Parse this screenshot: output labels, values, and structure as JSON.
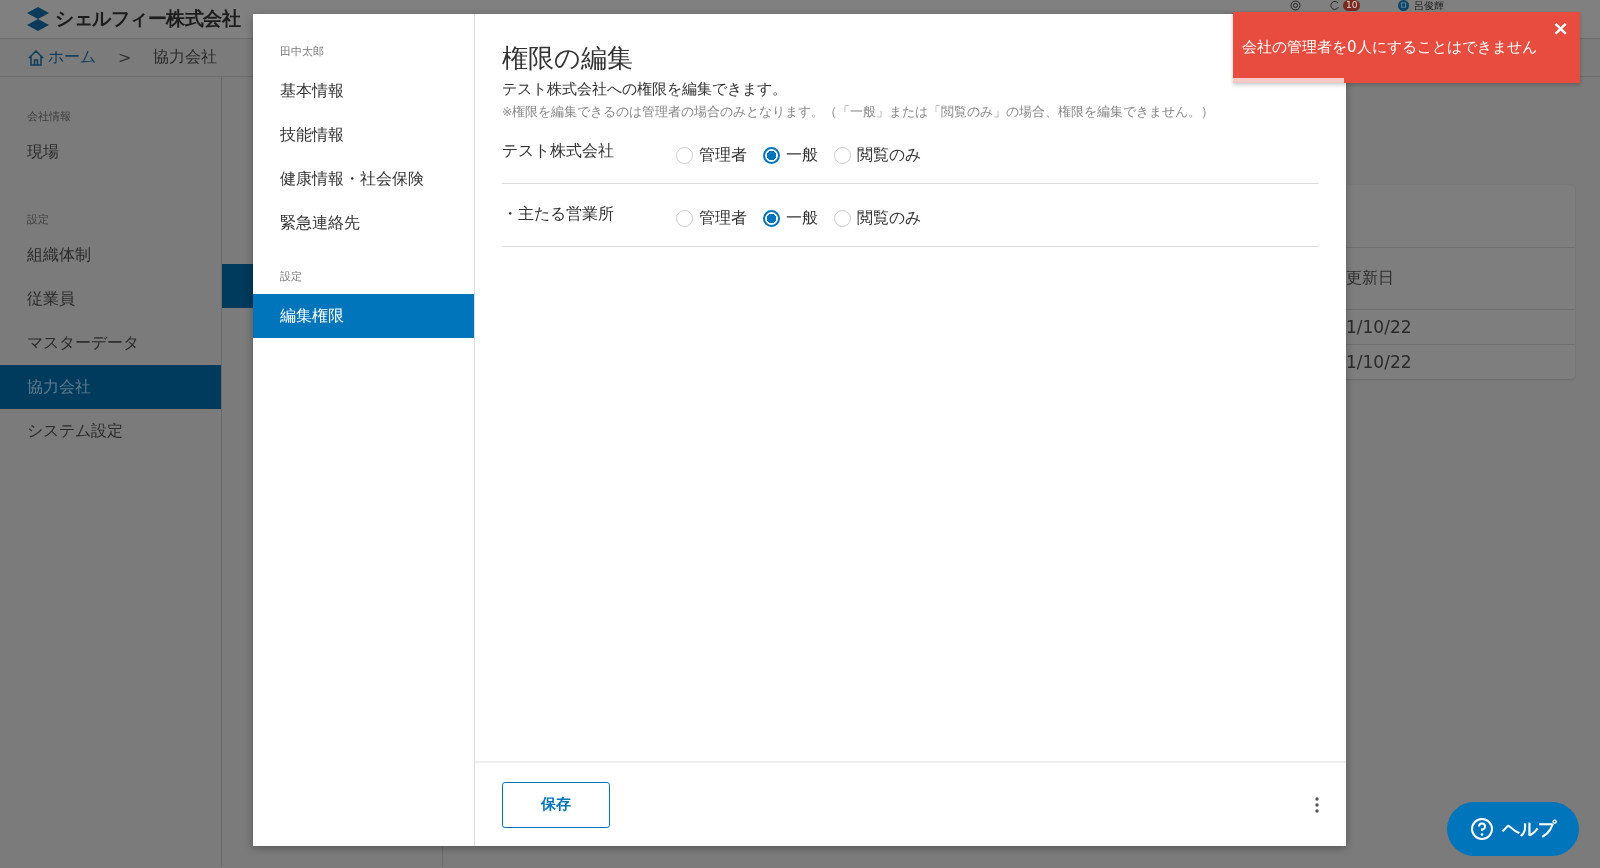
{
  "header": {
    "company_name": "シェルフィー株式会社",
    "notification_count": "10",
    "user_name": "呂俊輝"
  },
  "breadcrumb": [
    {
      "label": "ホーム",
      "kind": "home"
    },
    {
      "label": ">",
      "kind": "separator"
    },
    {
      "label": "協力会社",
      "kind": "current"
    }
  ],
  "sidebar": {
    "sections": [
      {
        "heading": "会社情報",
        "items": [
          {
            "label": "現場",
            "selected": false
          }
        ]
      },
      {
        "heading": "設定",
        "items": [
          {
            "label": "組織体制",
            "selected": false
          },
          {
            "label": "従業員",
            "selected": false
          },
          {
            "label": "マスターデータ",
            "selected": false
          },
          {
            "label": "協力会社",
            "selected": true
          },
          {
            "label": "システム設定",
            "selected": false
          }
        ]
      }
    ]
  },
  "background_table": {
    "columns": [
      "更新日"
    ],
    "rows": [
      [
        "1/10/22"
      ],
      [
        "1/10/22"
      ]
    ]
  },
  "modal": {
    "nav": {
      "sections": [
        {
          "heading": "田中太郎",
          "items": [
            {
              "label": "基本情報",
              "selected": false
            },
            {
              "label": "技能情報",
              "selected": false
            },
            {
              "label": "健康情報・社会保険",
              "selected": false
            },
            {
              "label": "緊急連絡先",
              "selected": false
            }
          ]
        },
        {
          "heading": "設定",
          "items": [
            {
              "label": "編集権限",
              "selected": true
            }
          ]
        }
      ]
    },
    "title": "権限の編集",
    "description": "テスト株式会社への権限を編集できます。",
    "note": "※権限を編集できるのは管理者の場合のみとなります。（「一般」または「閲覧のみ」の場合、権限を編集できません。）",
    "permissions": [
      {
        "name": "テスト株式会社",
        "options": [
          {
            "label": "管理者",
            "selected": false
          },
          {
            "label": "一般",
            "selected": true
          },
          {
            "label": "閲覧のみ",
            "selected": false
          }
        ]
      },
      {
        "name": "・主たる営業所",
        "options": [
          {
            "label": "管理者",
            "selected": false
          },
          {
            "label": "一般",
            "selected": true
          },
          {
            "label": "閲覧のみ",
            "selected": false
          }
        ]
      }
    ],
    "save_button": "保存"
  },
  "toast": {
    "message": "会社の管理者を0人にすることはできません",
    "close": "×",
    "level": 0.32
  },
  "help_button": "ヘルプ"
}
